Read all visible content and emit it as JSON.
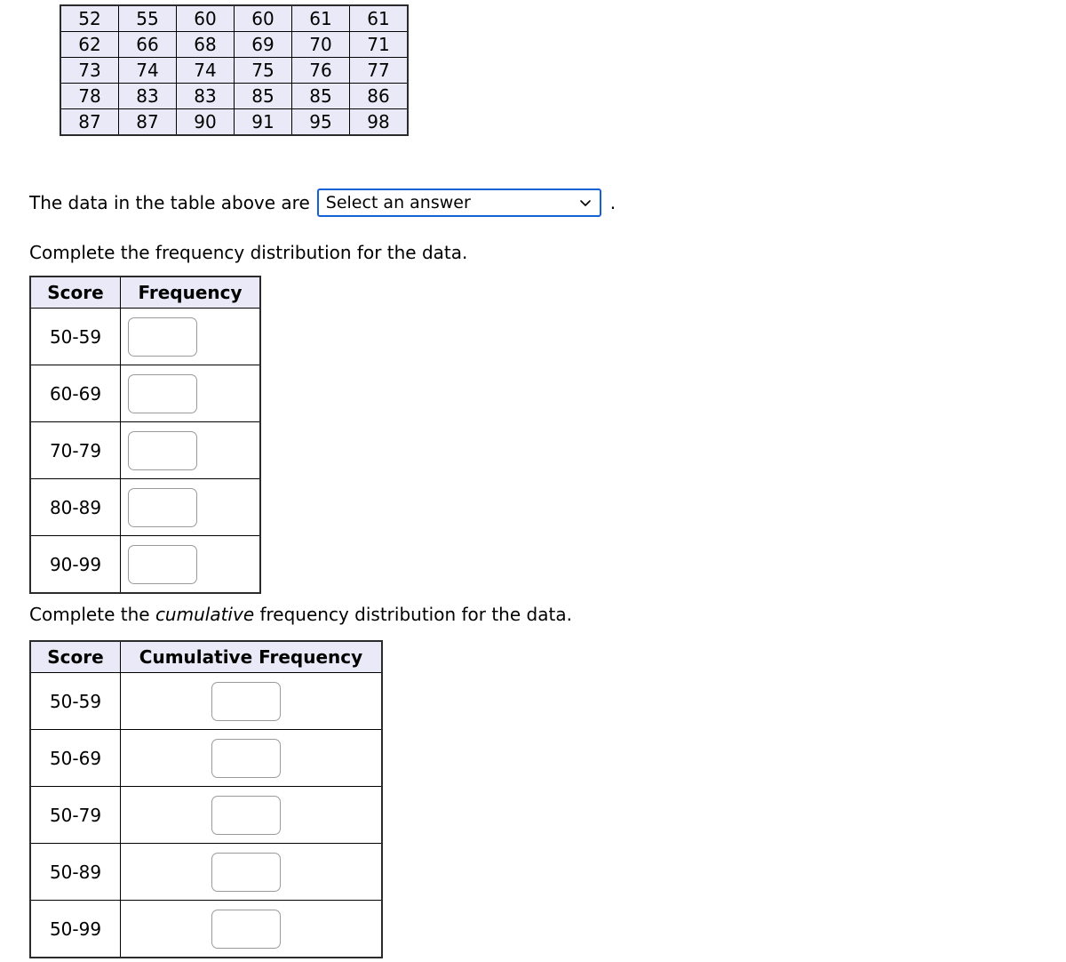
{
  "data_table": {
    "name": "raw-data-values",
    "rows": [
      [
        "52",
        "55",
        "60",
        "60",
        "61",
        "61"
      ],
      [
        "62",
        "66",
        "68",
        "69",
        "70",
        "71"
      ],
      [
        "73",
        "74",
        "74",
        "75",
        "76",
        "77"
      ],
      [
        "78",
        "83",
        "83",
        "85",
        "85",
        "86"
      ],
      [
        "87",
        "87",
        "90",
        "91",
        "95",
        "98"
      ]
    ]
  },
  "sentence": {
    "text": "The data in the table above are",
    "period": ".",
    "select": {
      "selected": "Select an answer",
      "icon": "chevron-down-icon",
      "border_color": "#1363d4"
    }
  },
  "frequency_section": {
    "prompt_before": "Complete the frequency distribution for the data.",
    "headers": [
      "Score",
      "Frequency"
    ],
    "rows": [
      {
        "score": "50-59",
        "value": ""
      },
      {
        "score": "60-69",
        "value": ""
      },
      {
        "score": "70-79",
        "value": ""
      },
      {
        "score": "80-89",
        "value": ""
      },
      {
        "score": "90-99",
        "value": ""
      }
    ]
  },
  "cumulative_section": {
    "prompt_part1": "Complete the ",
    "prompt_emphasis": "cumulative",
    "prompt_part2": " frequency distribution for the data.",
    "headers": [
      "Score",
      "Cumulative Frequency"
    ],
    "rows": [
      {
        "score": "50-59",
        "value": ""
      },
      {
        "score": "50-69",
        "value": ""
      },
      {
        "score": "50-79",
        "value": ""
      },
      {
        "score": "50-89",
        "value": ""
      },
      {
        "score": "50-99",
        "value": ""
      }
    ]
  },
  "colors": {
    "cell_fill": "#e9e9f7",
    "border": "#000000",
    "input_border": "#9b9b9b",
    "select_border": "#1363d4"
  }
}
